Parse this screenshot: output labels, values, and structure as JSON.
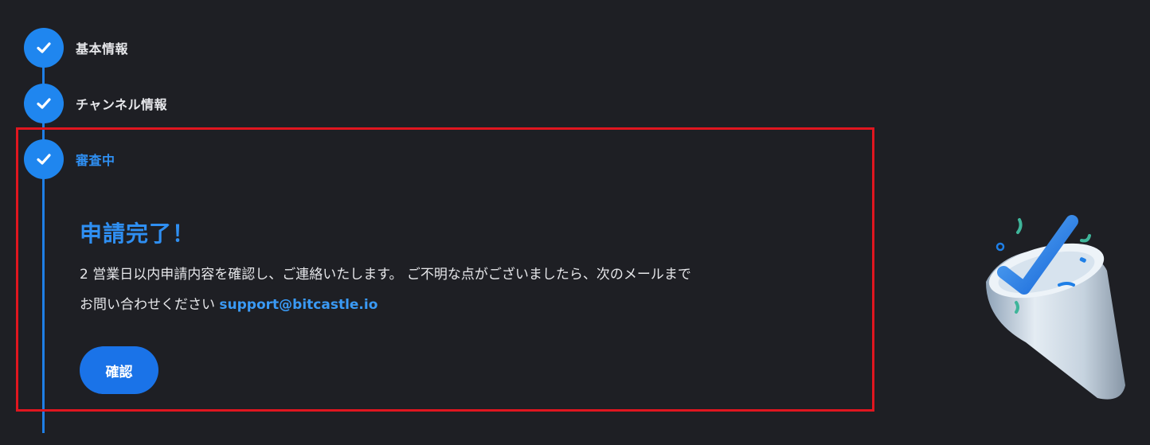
{
  "steps": [
    {
      "label": "基本情報",
      "state": "completed"
    },
    {
      "label": "チャンネル情報",
      "state": "completed"
    },
    {
      "label": "審査中",
      "state": "active"
    }
  ],
  "main": {
    "title": "申請完了！",
    "description_line1": "2 営業日以内申請内容を確認し、ご連絡いたします。 ご不明な点がございましたら、次のメールまで",
    "description_line2_prefix": "お問い合わせください",
    "support_email": "support@bitcastle.io",
    "confirm_button": "確認"
  },
  "colors": {
    "background": "#1e1f24",
    "accent": "#1f86ef",
    "button": "#1a73e8",
    "highlight_border": "#e0161f"
  },
  "icons": {
    "step_icon": "check-icon",
    "illustration": "party-popper-check-illustration"
  }
}
